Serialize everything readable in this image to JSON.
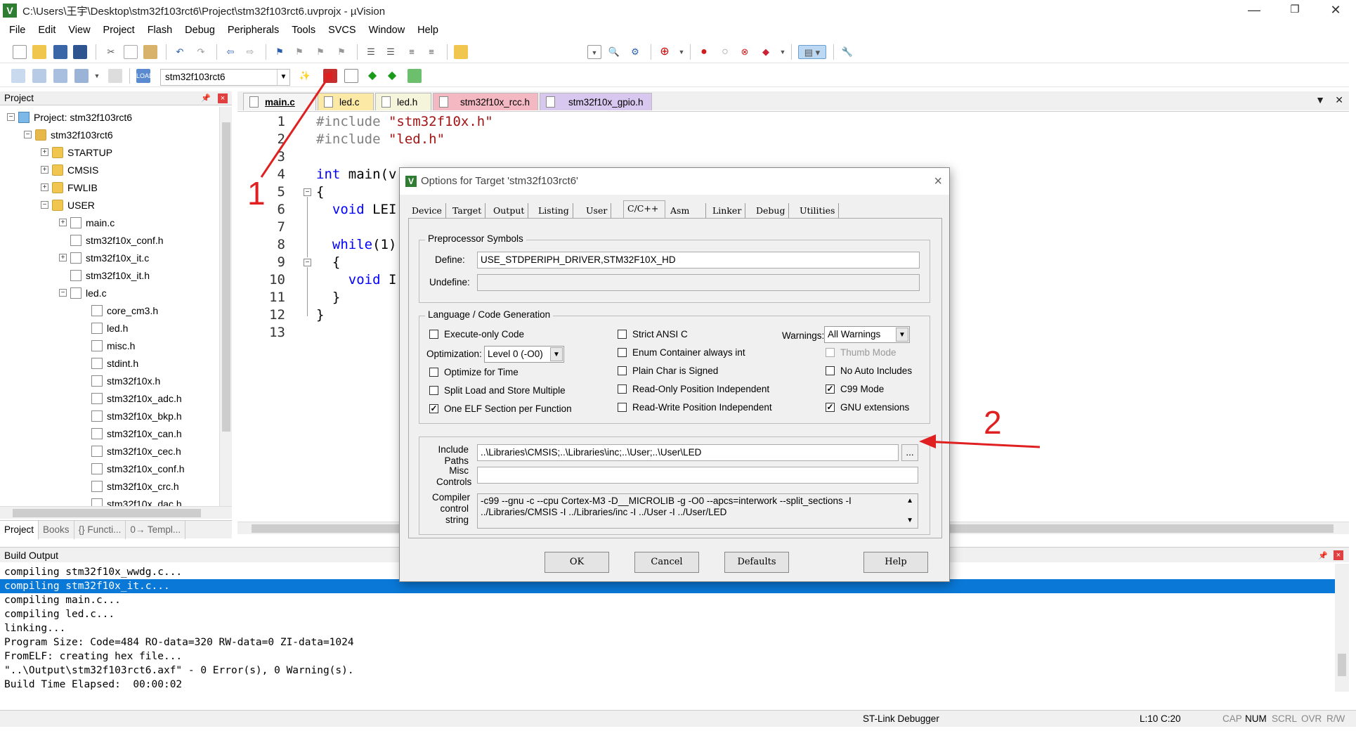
{
  "window": {
    "title": "C:\\Users\\王宇\\Desktop\\stm32f103rct6\\Project\\stm32f103rct6.uvprojx - µVision",
    "minimize": "—",
    "maximize": "❐",
    "close": "✕"
  },
  "menu": [
    "File",
    "Edit",
    "View",
    "Project",
    "Flash",
    "Debug",
    "Peripherals",
    "Tools",
    "SVCS",
    "Window",
    "Help"
  ],
  "toolbar": {
    "target_select": "stm32f103rct6"
  },
  "project_panel": {
    "title": "Project",
    "tree": [
      {
        "label": "Project: stm32f103rct6",
        "expander": "−",
        "icon": "project"
      },
      {
        "label": "stm32f103rct6",
        "expander": "−",
        "icon": "target"
      },
      {
        "label": "STARTUP",
        "expander": "+",
        "icon": "folder"
      },
      {
        "label": "CMSIS",
        "expander": "+",
        "icon": "folder"
      },
      {
        "label": "FWLIB",
        "expander": "+",
        "icon": "folder"
      },
      {
        "label": "USER",
        "expander": "−",
        "icon": "folder"
      },
      {
        "label": "main.c",
        "expander": "+",
        "icon": "file"
      },
      {
        "label": "stm32f10x_conf.h",
        "expander": "",
        "icon": "file"
      },
      {
        "label": "stm32f10x_it.c",
        "expander": "+",
        "icon": "file"
      },
      {
        "label": "stm32f10x_it.h",
        "expander": "",
        "icon": "file"
      },
      {
        "label": "led.c",
        "expander": "−",
        "icon": "file"
      },
      {
        "label": "core_cm3.h",
        "expander": "",
        "icon": "file"
      },
      {
        "label": "led.h",
        "expander": "",
        "icon": "file"
      },
      {
        "label": "misc.h",
        "expander": "",
        "icon": "file"
      },
      {
        "label": "stdint.h",
        "expander": "",
        "icon": "file"
      },
      {
        "label": "stm32f10x.h",
        "expander": "",
        "icon": "file"
      },
      {
        "label": "stm32f10x_adc.h",
        "expander": "",
        "icon": "file"
      },
      {
        "label": "stm32f10x_bkp.h",
        "expander": "",
        "icon": "file"
      },
      {
        "label": "stm32f10x_can.h",
        "expander": "",
        "icon": "file"
      },
      {
        "label": "stm32f10x_cec.h",
        "expander": "",
        "icon": "file"
      },
      {
        "label": "stm32f10x_conf.h",
        "expander": "",
        "icon": "file"
      },
      {
        "label": "stm32f10x_crc.h",
        "expander": "",
        "icon": "file"
      },
      {
        "label": "stm32f10x_dac.h",
        "expander": "",
        "icon": "file"
      }
    ],
    "tabs": [
      "Project",
      "Books",
      "{} Functi...",
      "0→ Templ..."
    ]
  },
  "editor": {
    "tabs": [
      {
        "label": "main.c",
        "color": "#f5f5f5",
        "active": true
      },
      {
        "label": "led.c",
        "color": "#fbe9a5"
      },
      {
        "label": "led.h",
        "color": "#f5f5dc"
      },
      {
        "label": "stm32f10x_rcc.h",
        "color": "#f4b8c2"
      },
      {
        "label": "stm32f10x_gpio.h",
        "color": "#d8c7ee"
      }
    ],
    "lines": [
      "1",
      "2",
      "3",
      "4",
      "5",
      "6",
      "7",
      "8",
      "9",
      "10",
      "11",
      "12",
      "13"
    ],
    "code": {
      "l1a": "#include ",
      "l1b": "\"stm32f10x.h\"",
      "l2a": "#include ",
      "l2b": "\"led.h\"",
      "l4a": "int",
      "l4b": " main(v",
      "l5": "{",
      "l6a": "  void",
      "l6b": " LEI",
      "l8a": "  while",
      "l8b": "(1)",
      "l9": "  {",
      "l10a": "    void",
      "l10b": " I",
      "l11": "  }",
      "l12": "}"
    }
  },
  "dialog": {
    "title": "Options for Target 'stm32f103rct6'",
    "tabs": [
      "Device",
      "Target",
      "Output",
      "Listing",
      "User",
      "C/C++",
      "Asm",
      "Linker",
      "Debug",
      "Utilities"
    ],
    "preprocessor": {
      "legend": "Preprocessor Symbols",
      "define_label": "Define:",
      "define_value": "USE_STDPERIPH_DRIVER,STM32F10X_HD",
      "undefine_label": "Undefine:",
      "undefine_value": ""
    },
    "language": {
      "legend": "Language / Code Generation",
      "execute_only": "Execute-only Code",
      "optimization_label": "Optimization:",
      "optimization_value": "Level 0 (-O0)",
      "optimize_time": "Optimize for Time",
      "split_load": "Split Load and Store Multiple",
      "one_elf": "One ELF Section per Function",
      "strict_ansi": "Strict ANSI C",
      "enum_container": "Enum Container always int",
      "plain_char": "Plain Char is Signed",
      "ro_pi": "Read-Only Position Independent",
      "rw_pi": "Read-Write Position Independent",
      "warnings_label": "Warnings:",
      "warnings_value": "All Warnings",
      "thumb_mode": "Thumb Mode",
      "no_auto_includes": "No Auto Includes",
      "c99_mode": "C99 Mode",
      "gnu_ext": "GNU extensions"
    },
    "include_paths_label_1": "Include",
    "include_paths_label_2": "Paths",
    "include_paths_value": "..\\Libraries\\CMSIS;..\\Libraries\\inc;..\\User;..\\User\\LED",
    "browse": "...",
    "misc_label_1": "Misc",
    "misc_label_2": "Controls",
    "misc_value": "",
    "compiler_label_1": "Compiler",
    "compiler_label_2": "control",
    "compiler_label_3": "string",
    "compiler_line_1": "-c99 --gnu -c --cpu Cortex-M3 -D__MICROLIB -g -O0 --apcs=interwork --split_sections -I",
    "compiler_line_2": "../Libraries/CMSIS -I ../Libraries/inc -I ../User -I ../User/LED",
    "buttons": {
      "ok": "OK",
      "cancel": "Cancel",
      "defaults": "Defaults",
      "help": "Help"
    }
  },
  "build_output": {
    "title": "Build Output",
    "lines": [
      "compiling stm32f10x_wwdg.c...",
      "compiling stm32f10x_it.c...",
      "compiling main.c...",
      "compiling led.c...",
      "linking...",
      "Program Size: Code=484 RO-data=320 RW-data=0 ZI-data=1024",
      "FromELF: creating hex file...",
      "\"..\\Output\\stm32f103rct6.axf\" - 0 Error(s), 0 Warning(s).",
      "Build Time Elapsed:  00:00:02"
    ]
  },
  "status": {
    "debugger": "ST-Link Debugger",
    "position": "L:10 C:20",
    "cap": "CAP",
    "num": "NUM",
    "scrl": "SCRL",
    "ovr": "OVR",
    "rw": "R/W"
  },
  "annotations": {
    "one": "1",
    "two": "2",
    "color": "#e02020"
  }
}
